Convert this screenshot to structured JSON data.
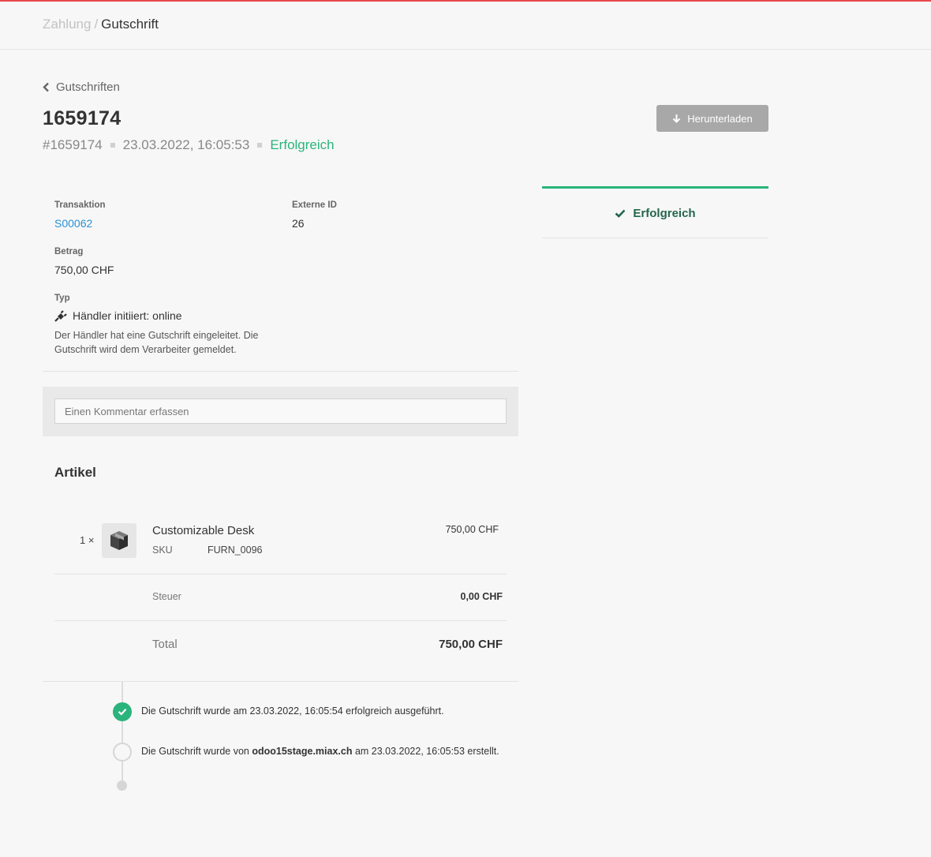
{
  "breadcrumb": {
    "parent": "Zahlung",
    "separator": "/",
    "current": "Gutschrift"
  },
  "back_link": "Gutschriften",
  "title": "1659174",
  "meta": {
    "reference": "#1659174",
    "datetime": "23.03.2022, 16:05:53",
    "status": "Erfolgreich"
  },
  "download_button": "Herunterladen",
  "status_card": "Erfolgreich",
  "fields": {
    "transaction_label": "Transaktion",
    "transaction_value": "S00062",
    "external_id_label": "Externe ID",
    "external_id_value": "26",
    "amount_label": "Betrag",
    "amount_value": "750,00 CHF",
    "type_label": "Typ",
    "type_value": "Händler initiiert: online",
    "type_description": "Der Händler hat eine Gutschrift eingeleitet. Die Gutschrift wird dem Verarbeiter gemeldet."
  },
  "comment": {
    "placeholder": "Einen Kommentar erfassen"
  },
  "items": {
    "heading": "Artikel",
    "line": {
      "qty": "1 ×",
      "name": "Customizable Desk",
      "sku_label": "SKU",
      "sku_value": "FURN_0096",
      "price": "750,00 CHF"
    },
    "tax_label": "Steuer",
    "tax_value": "0,00 CHF",
    "total_label": "Total",
    "total_value": "750,00 CHF"
  },
  "timeline": {
    "entry1": "Die Gutschrift wurde am 23.03.2022, 16:05:54 erfolgreich ausgeführt.",
    "entry2_prefix": "Die Gutschrift wurde von ",
    "entry2_host": "odoo15stage.miax.ch",
    "entry2_suffix": " am 23.03.2022, 16:05:53 erstellt."
  },
  "colors": {
    "success": "#2bb37c",
    "link": "#2a93d5",
    "accent_line": "#e8474a"
  }
}
